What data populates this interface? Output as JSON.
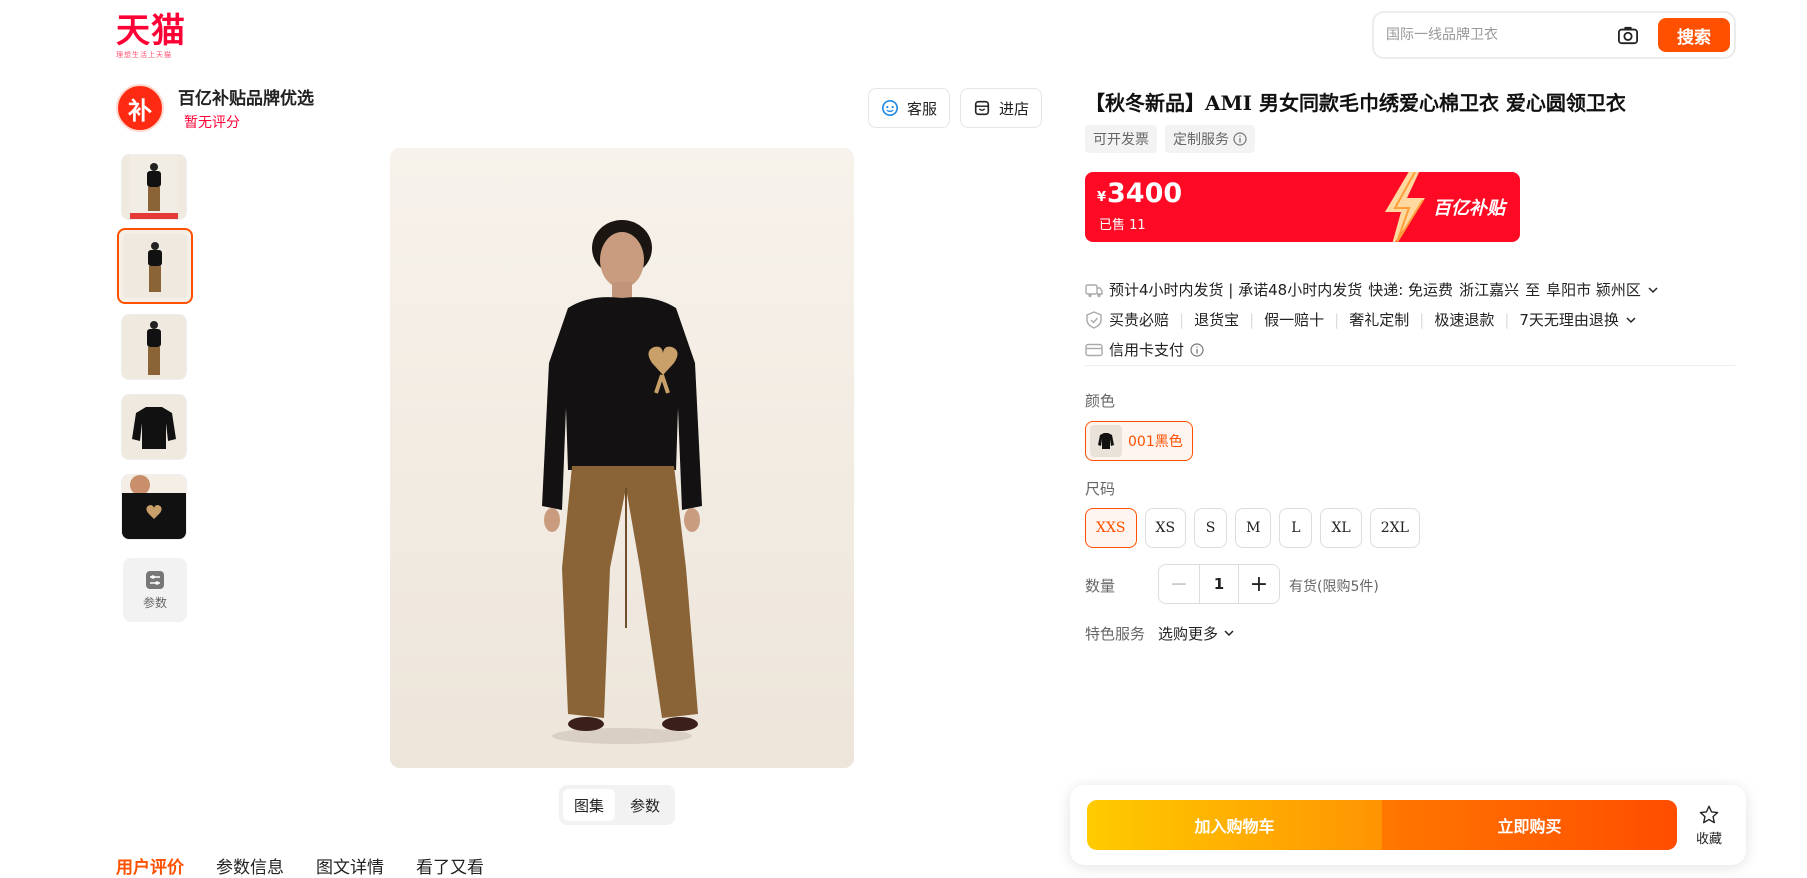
{
  "header": {
    "logo_text": "天猫",
    "logo_slogan": "理想生活上天猫",
    "search_placeholder": "国际一线品牌卫衣",
    "search_button": "搜索"
  },
  "shop": {
    "logo_char": "补",
    "name": "百亿补贴品牌优选",
    "rating": "暂无评分",
    "service_label": "客服",
    "enter_label": "进店"
  },
  "gallery": {
    "param_label": "参数",
    "tabs": [
      "图集",
      "参数"
    ]
  },
  "bottom_tabs": [
    "用户评价",
    "参数信息",
    "图文详情",
    "看了又看"
  ],
  "product": {
    "title": "【秋冬新品】AMI 男女同款毛巾绣爱心棉卫衣 爱心圆领卫衣",
    "tags": [
      "可开发票",
      "定制服务"
    ],
    "currency": "¥",
    "price": "3400",
    "sold": "已售 11",
    "subsidy_label": "百亿补贴",
    "shipping": {
      "text": "预计4小时内发货 | 承诺48小时内发货",
      "express": "快递: 免运费",
      "from": "浙江嘉兴",
      "to_word": "至",
      "to": "阜阳市 颍州区"
    },
    "guarantees": [
      "买贵必赔",
      "退货宝",
      "假一赔十",
      "奢礼定制",
      "极速退款",
      "7天无理由退换"
    ],
    "payment": "信用卡支付",
    "color_label": "颜色",
    "color_option": "001黑色",
    "size_label": "尺码",
    "sizes": [
      "XXS",
      "XS",
      "S",
      "M",
      "L",
      "XL",
      "2XL"
    ],
    "quantity_label": "数量",
    "quantity": "1",
    "stock": "有货(限购5件)",
    "service_label": "特色服务",
    "service_more": "选购更多"
  },
  "buybar": {
    "cart": "加入购物车",
    "buy": "立即购买",
    "fav": "收藏"
  },
  "colors": {
    "brand": "#ff0036",
    "accent": "#ff5000",
    "subsidy_red": "#ff0a24"
  }
}
